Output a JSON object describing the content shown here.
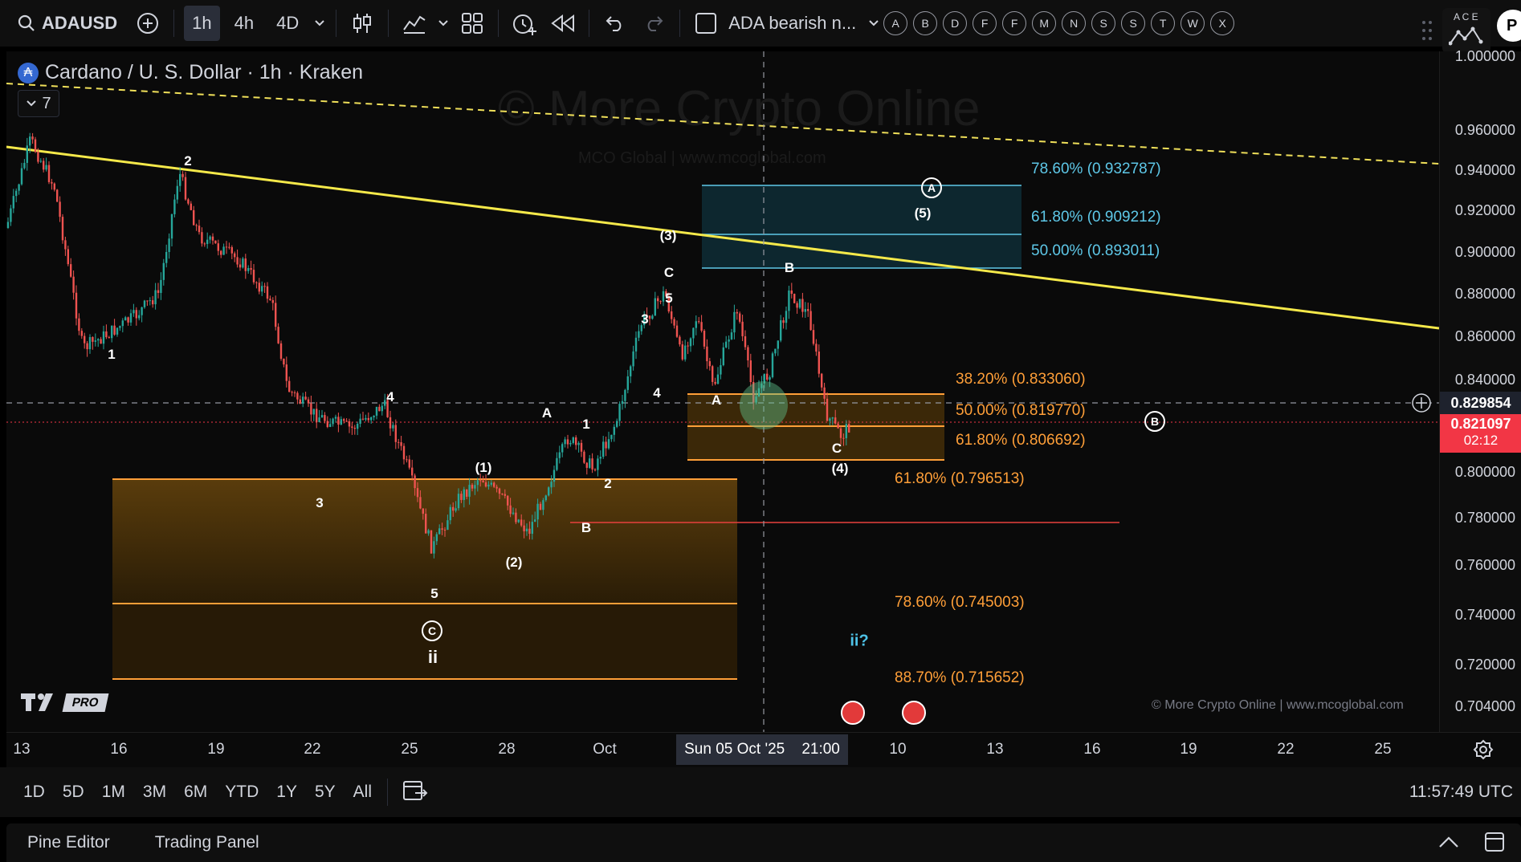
{
  "toolbar": {
    "symbol": "ADAUSD",
    "timeframes": [
      "1h",
      "4h",
      "4D"
    ],
    "active_timeframe": "1h",
    "layout_name": "ADA bearish n...",
    "alert_letters": [
      "A",
      "B",
      "D",
      "F",
      "F",
      "M",
      "N",
      "S",
      "S",
      "T",
      "W",
      "X"
    ],
    "corner_letters": "A C E",
    "profile_initial": "P"
  },
  "legend": {
    "title": "Cardano / U. S. Dollar · 1h · Kraken",
    "coin_symbol": "₳",
    "collapsed_count": "7"
  },
  "watermark": {
    "title": "© More Crypto Online",
    "subtitle": "MCO Global   |   www.mcoglobal.com"
  },
  "copyright": "© More Crypto Online   |   www.mcoglobal.com",
  "pro_badge": "PRO",
  "price_scale": {
    "ticks": [
      "1.000000",
      "0.960000",
      "0.940000",
      "0.920000",
      "0.900000",
      "0.880000",
      "0.860000",
      "0.840000",
      "0.800000",
      "0.780000",
      "0.760000",
      "0.740000",
      "0.720000",
      "0.704000"
    ],
    "crosshair_price": "0.829854",
    "last_price": "0.821097",
    "countdown": "02:12",
    "crosshair_color": "#1e222d",
    "last_price_color": "#f23645"
  },
  "time_axis": {
    "ticks": [
      "13",
      "16",
      "19",
      "22",
      "25",
      "28",
      "Oct",
      "10",
      "13",
      "16",
      "19",
      "22",
      "25"
    ],
    "crosshair_label": "Sun 05 Oct '25    21:00"
  },
  "fib_levels": {
    "upper": [
      "78.60% (0.932787)",
      "61.80% (0.909212)",
      "50.00% (0.893011)"
    ],
    "middle": [
      "38.20% (0.833060)",
      "50.00% (0.819770)",
      "61.80% (0.806692)"
    ],
    "lower": [
      "61.80% (0.796513)",
      "78.60% (0.745003)",
      "88.70% (0.715652)"
    ],
    "upper_color": "#5ec8e8",
    "orange_color": "#ff9f38"
  },
  "wave_labels": {
    "a1": "1",
    "a2": "2",
    "a3": "3",
    "a4": "4",
    "a5": "5",
    "c_circle": "C",
    "ii": "ii",
    "w1": "(1)",
    "w2": "(2)",
    "w3": "(3)",
    "w4": "(4)",
    "w5": "(5)",
    "b_A": "A",
    "b_1": "1",
    "b_2": "2",
    "b_B": "B",
    "c_3": "3",
    "c_4": "4",
    "c_5": "5",
    "c_C": "C",
    "d_A": "A",
    "d_B": "B",
    "d_C": "C",
    "circle_A": "A",
    "circle_B": "B",
    "ii_question": "ii?"
  },
  "bottom_bar": {
    "ranges": [
      "1D",
      "5D",
      "1M",
      "3M",
      "6M",
      "YTD",
      "1Y",
      "5Y",
      "All"
    ],
    "clock": "11:57:49 UTC"
  },
  "panels": {
    "pine_editor": "Pine Editor",
    "trading_panel": "Trading Panel"
  }
}
